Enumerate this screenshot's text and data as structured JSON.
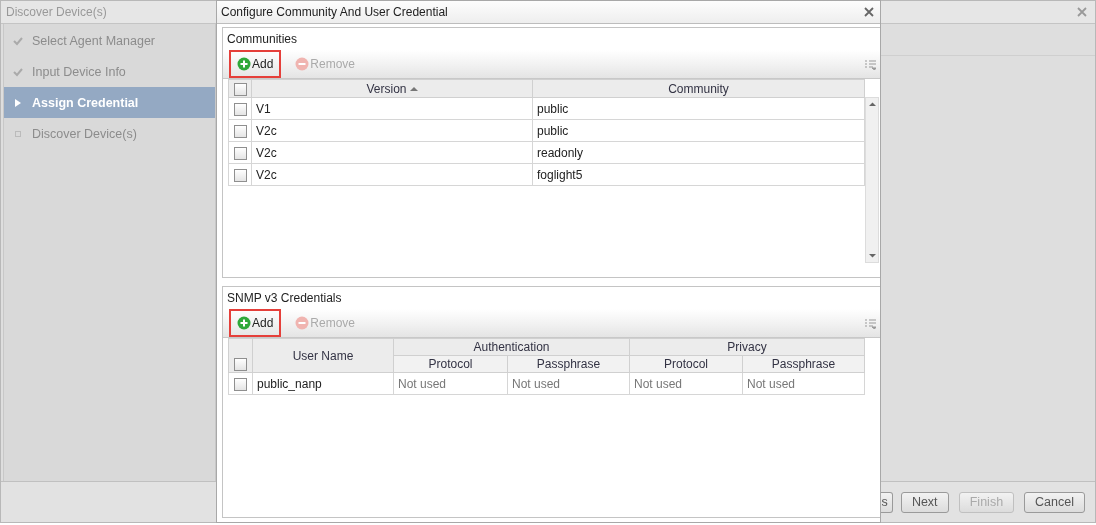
{
  "wizard": {
    "title": "Discover Device(s)",
    "steps": [
      {
        "label": "Select Agent Manager",
        "done": true,
        "selected": false
      },
      {
        "label": "Input Device Info",
        "done": true,
        "selected": false
      },
      {
        "label": "Assign Credential",
        "done": false,
        "selected": true
      },
      {
        "label": "Discover Device(s)",
        "done": false,
        "selected": false
      }
    ],
    "buttons": [
      {
        "label": "s",
        "disabled": false
      },
      {
        "label": "Next",
        "disabled": false
      },
      {
        "label": "Finish",
        "disabled": true
      },
      {
        "label": "Cancel",
        "disabled": false
      }
    ]
  },
  "dialog": {
    "title": "Configure Community And User Credential",
    "communities": {
      "title": "Communities",
      "toolbar": [
        {
          "label": "Add",
          "kind": "add",
          "disabled": false,
          "highlighted": true
        },
        {
          "label": "Remove",
          "kind": "remove",
          "disabled": true,
          "highlighted": false
        }
      ],
      "all_checked": false,
      "columns": [
        {
          "label": "Version",
          "sorted": true
        },
        {
          "label": "Community",
          "sorted": false
        }
      ],
      "rows": [
        {
          "checked": false,
          "cells": [
            "V1",
            "public"
          ]
        },
        {
          "checked": false,
          "cells": [
            "V2c",
            "public"
          ]
        },
        {
          "checked": false,
          "cells": [
            "V2c",
            "readonly"
          ]
        },
        {
          "checked": false,
          "cells": [
            "V2c",
            "foglight5"
          ]
        }
      ]
    },
    "snmp_v3": {
      "title": "SNMP v3 Credentials",
      "toolbar": [
        {
          "label": "Add",
          "kind": "add",
          "disabled": false,
          "highlighted": true
        },
        {
          "label": "Remove",
          "kind": "remove",
          "disabled": true,
          "highlighted": false
        }
      ],
      "all_checked": false,
      "header_rows": [
        [
          {
            "label": "User Name",
            "rowspan": 2
          },
          {
            "label": "Authentication",
            "colspan": 2
          },
          {
            "label": "Privacy",
            "colspan": 2
          }
        ],
        [
          {
            "label": "Protocol"
          },
          {
            "label": "Passphrase"
          },
          {
            "label": "Protocol"
          },
          {
            "label": "Passphrase"
          }
        ]
      ],
      "rows": [
        {
          "checked": false,
          "cells": [
            "public_nanp",
            "Not used",
            "Not used",
            "Not used",
            "Not used"
          ]
        }
      ]
    }
  }
}
